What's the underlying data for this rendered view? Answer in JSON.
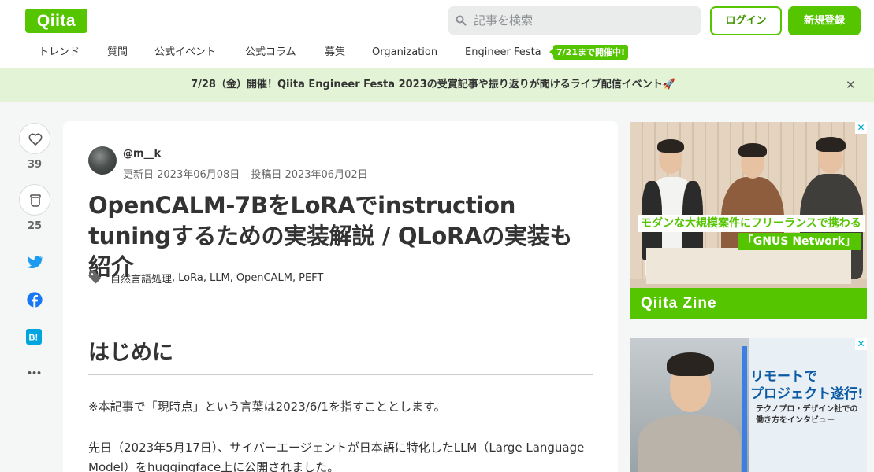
{
  "header": {
    "logo_text": "Qiita",
    "search_placeholder": "記事を検索",
    "login_label": "ログイン",
    "signup_label": "新規登録",
    "nav": [
      "トレンド",
      "質問",
      "公式イベント",
      "公式コラム",
      "募集",
      "Organization",
      "Engineer Festa"
    ],
    "festa_badge": "7/21まで開催中!"
  },
  "banner": {
    "text": "7/28（金）開催！Qiita Engineer Festa 2023の受賞記事や振り返りが聞けるライブ配信イベント🚀",
    "close": "✕"
  },
  "actions": {
    "likes": "39",
    "stocks": "25",
    "more": "•••"
  },
  "article": {
    "author": "@m__k",
    "updated": "更新日 2023年06月08日",
    "posted": "投稿日 2023年06月02日",
    "title": "OpenCALM-7BをLoRAでinstruction tuningするための実装解説 / QLoRAの実装も紹介",
    "tags": [
      "自然言語処理",
      "LoRa",
      "LLM",
      "OpenCALM",
      "PEFT"
    ],
    "section_heading": "はじめに",
    "paragraphs": [
      "※本記事で「現時点」という言葉は2023/6/1を指すこととします。",
      "先日（2023年5月17日）、サイバーエージェントが日本語に特化したLLM（Large Language Model）をhuggingface上に公開されました。"
    ]
  },
  "ads": {
    "ad1_caption1": "モダンな大規模案件にフリーランスで携わる",
    "ad1_caption2": "「GNUS Network」",
    "ad1_footer": "Qiita Zine",
    "ad2_title_line1": "リモートで",
    "ad2_title_line2": "プロジェクト遂行!",
    "ad2_sub_line1": "テクノプロ・デザイン社での",
    "ad2_sub_line2": "働き方をインタビュー",
    "ad_close": "✕"
  },
  "colors": {
    "brand": "#55c500",
    "banner_bg": "#e3f4d6",
    "twitter": "#1d9bf0",
    "facebook": "#1877f2",
    "hatena": "#00a4de"
  }
}
